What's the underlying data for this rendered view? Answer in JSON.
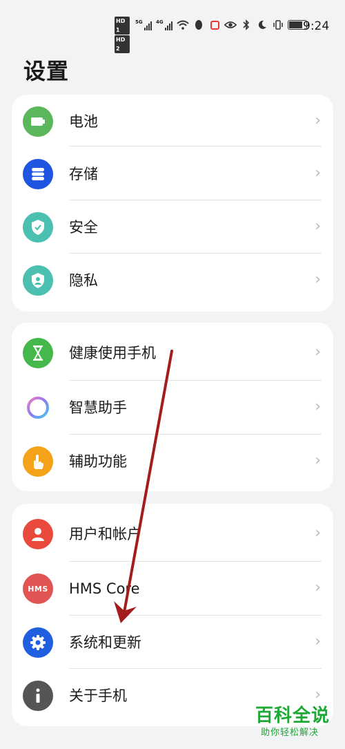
{
  "status_bar": {
    "hd_badges": [
      "HD 1",
      "HD 2"
    ],
    "network_1": "5G",
    "network_2": "4G",
    "icons": [
      "wifi-icon",
      "qq-penguin-icon",
      "red-square-notification-icon",
      "eye-icon",
      "bluetooth-icon",
      "moon-icon",
      "vibrate-icon",
      "battery-icon"
    ],
    "time": "9:24"
  },
  "page": {
    "title": "设置"
  },
  "groups": [
    {
      "items": [
        {
          "label": "电池",
          "icon": "battery-icon",
          "color": "#5bb75b"
        },
        {
          "label": "存储",
          "icon": "storage-icon",
          "color": "#1f55e0"
        },
        {
          "label": "安全",
          "icon": "shield-icon",
          "color": "#4bbfb0"
        },
        {
          "label": "隐私",
          "icon": "privacy-icon",
          "color": "#4bbfb0"
        }
      ]
    },
    {
      "items": [
        {
          "label": "健康使用手机",
          "icon": "hourglass-icon",
          "color": "#44b84a"
        },
        {
          "label": "智慧助手",
          "icon": "assistant-ring-icon",
          "color": "#b889f0"
        },
        {
          "label": "辅助功能",
          "icon": "hand-pointer-icon",
          "color": "#f4a21a"
        }
      ]
    },
    {
      "items": [
        {
          "label": "用户和帐户",
          "icon": "user-icon",
          "color": "#ea4a3c"
        },
        {
          "label": "HMS Core",
          "icon": "hms-icon",
          "icon_text": "HMS",
          "color": "#e25454"
        },
        {
          "label": "系统和更新",
          "icon": "gear-icon",
          "color": "#1f5fe0"
        },
        {
          "label": "关于手机",
          "icon": "info-icon",
          "color": "#555555"
        }
      ]
    }
  ],
  "chevron": "›",
  "watermark": {
    "title": "百科全说",
    "subtitle": "助你轻松解决"
  },
  "accent_colors": {
    "arrow": "#a41d1d",
    "watermark": "#1ea836"
  }
}
